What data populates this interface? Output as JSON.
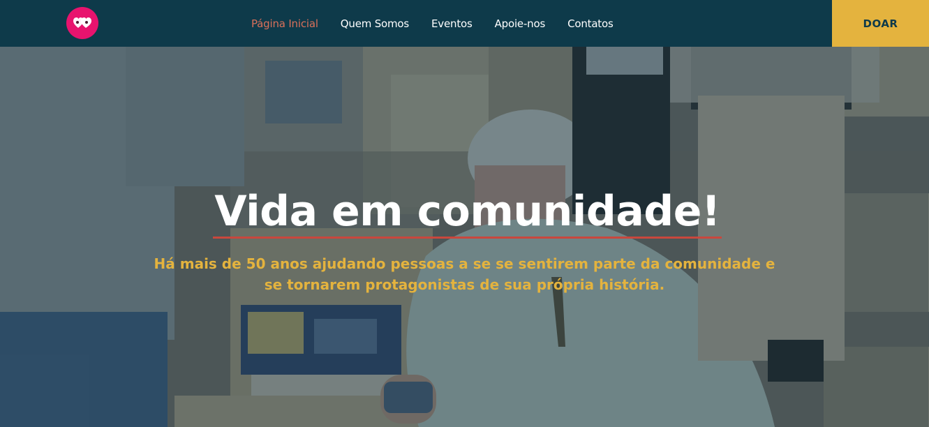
{
  "brand": {
    "logo_icon": "hearts-icon",
    "logo_color": "#e8136e"
  },
  "nav": {
    "items": [
      {
        "label": "Página Inicial",
        "active": true
      },
      {
        "label": "Quem Somos",
        "active": false
      },
      {
        "label": "Eventos",
        "active": false
      },
      {
        "label": "Apoie-nos",
        "active": false
      },
      {
        "label": "Contatos",
        "active": false
      }
    ],
    "donate_label": "DOAR"
  },
  "hero": {
    "title": "Vida em comunidade!",
    "subtitle_line1": "Há mais de 50 anos ajudando pessoas a se se sentirem parte da comunidade e",
    "subtitle_line2": "se tornarem protagonistas de sua própria história."
  },
  "colors": {
    "nav_bg": "#0e3a4a",
    "accent_active": "#d9705a",
    "donate_bg": "#e4b33e",
    "subtitle": "#e4b33e",
    "title_underline": "#c9473d"
  }
}
